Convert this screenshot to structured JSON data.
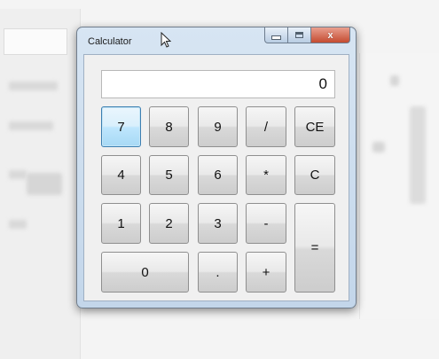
{
  "window": {
    "title": "Calculator",
    "caption_buttons": {
      "close": "x"
    }
  },
  "display": {
    "value": "0"
  },
  "keys": {
    "k7": "7",
    "k8": "8",
    "k9": "9",
    "divide": "/",
    "clear_entry": "CE",
    "k4": "4",
    "k5": "5",
    "k6": "6",
    "multiply": "*",
    "clear": "C",
    "k1": "1",
    "k2": "2",
    "k3": "3",
    "subtract": "-",
    "equals": "=",
    "k0": "0",
    "decimal": ".",
    "add": "+"
  },
  "focused_key": "7",
  "colors": {
    "accent": "#3c7fb1",
    "close_button": "#c44b30",
    "frame": "#c3d6ea"
  },
  "icons": {
    "cursor": "mouse-pointer-icon"
  }
}
